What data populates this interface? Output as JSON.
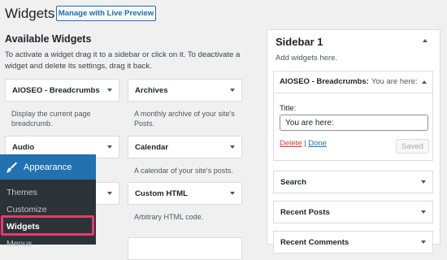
{
  "page": {
    "title": "Widgets",
    "preview_button": "Manage with Live Preview"
  },
  "available": {
    "heading": "Available Widgets",
    "description": "To activate a widget drag it to a sidebar or click on it. To deactivate a widget and delete its settings, drag it back.",
    "widgets": [
      {
        "label": "AIOSEO - Breadcrumbs",
        "desc": "Display the current page breadcrumb."
      },
      {
        "label": "Archives",
        "desc": "A monthly archive of your site's Posts."
      },
      {
        "label": "Audio",
        "desc": ""
      },
      {
        "label": "Calendar",
        "desc": "A calendar of your site's posts."
      },
      {
        "label": "",
        "desc": ""
      },
      {
        "label": "Custom HTML",
        "desc": "Arbitrary HTML code."
      }
    ]
  },
  "sidebar": {
    "title": "Sidebar 1",
    "description": "Add widgets here.",
    "expanded_widget": {
      "name": "AIOSEO - Breadcrumbs:",
      "subtitle": "You are here:",
      "title_label": "Title:",
      "title_value": "You are here:",
      "delete_label": "Delete",
      "separator": "|",
      "done_label": "Done",
      "saved_label": "Saved"
    },
    "widgets": [
      {
        "label": "Search"
      },
      {
        "label": "Recent Posts"
      },
      {
        "label": "Recent Comments"
      }
    ]
  },
  "admin_menu": {
    "section": "Appearance",
    "items": [
      {
        "label": "Themes"
      },
      {
        "label": "Customize"
      },
      {
        "label": "Widgets"
      },
      {
        "label": "Menus"
      }
    ]
  },
  "colors": {
    "accent": "#2271b1",
    "menu_bg": "#2c3338",
    "highlight": "#e63a6a",
    "delete": "#d63638"
  }
}
